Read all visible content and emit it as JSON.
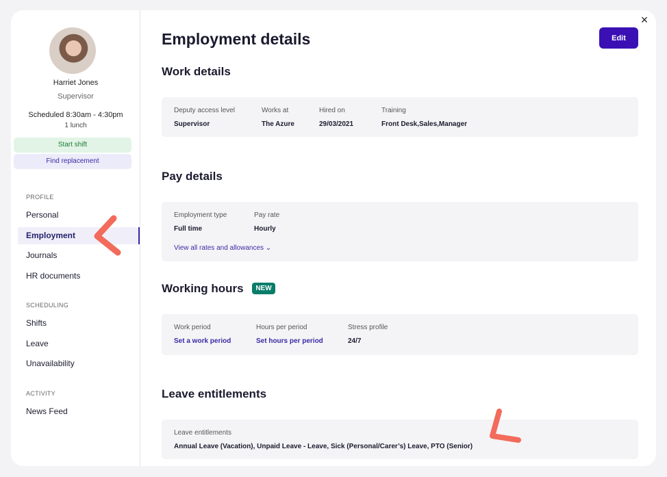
{
  "profile": {
    "name": "Harriet Jones",
    "role": "Supervisor",
    "schedule": "Scheduled 8:30am - 4:30pm",
    "lunch": "1 lunch",
    "start_shift_label": "Start shift",
    "find_replacement_label": "Find replacement"
  },
  "sidebar": {
    "profile_heading": "PROFILE",
    "profile_items": [
      "Personal",
      "Employment",
      "Journals",
      "HR documents"
    ],
    "scheduling_heading": "SCHEDULING",
    "scheduling_items": [
      "Shifts",
      "Leave",
      "Unavailability"
    ],
    "activity_heading": "ACTIVITY",
    "activity_items": [
      "News Feed"
    ]
  },
  "main": {
    "title": "Employment details",
    "edit_label": "Edit",
    "close_icon": "×",
    "work_details": {
      "heading": "Work details",
      "fields": [
        {
          "label": "Deputy access level",
          "value": "Supervisor"
        },
        {
          "label": "Works at",
          "value": "The Azure"
        },
        {
          "label": "Hired on",
          "value": "29/03/2021"
        },
        {
          "label": "Training",
          "value": "Front Desk,Sales,Manager"
        }
      ]
    },
    "pay_details": {
      "heading": "Pay details",
      "fields": [
        {
          "label": "Employment type",
          "value": "Full time"
        },
        {
          "label": "Pay rate",
          "value": "Hourly"
        }
      ],
      "rates_link": "View all rates and allowances ⌄"
    },
    "working_hours": {
      "heading": "Working hours",
      "badge": "NEW",
      "fields": [
        {
          "label": "Work period",
          "value": "Set a work period"
        },
        {
          "label": "Hours per period",
          "value": "Set hours per period"
        },
        {
          "label": "Stress profile",
          "value": "24/7"
        }
      ]
    },
    "leave": {
      "heading": "Leave entitlements",
      "label": "Leave entitlements",
      "value": "Annual Leave (Vacation), Unpaid Leave - Leave, Sick (Personal/Carer’s) Leave, PTO (Senior)"
    }
  },
  "colors": {
    "accent": "#3a10b5",
    "badge": "#0a7d6a",
    "annotation": "#f26b5b"
  }
}
